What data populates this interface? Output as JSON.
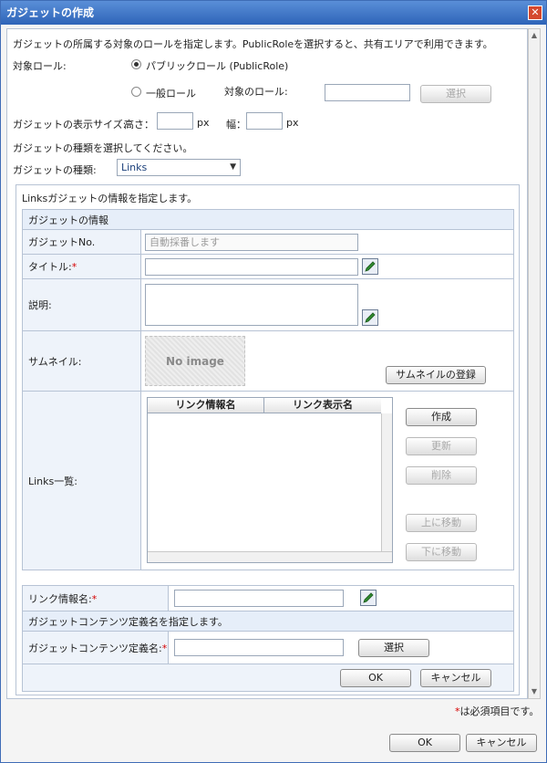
{
  "window": {
    "title": "ガジェットの作成"
  },
  "role": {
    "intro": "ガジェットの所属する対象のロールを指定します。PublicRoleを選択すると、共有エリアで利用できます。",
    "label": "対象ロール:",
    "public_option": "パブリックロール (PublicRole)",
    "general_option": "一般ロール",
    "target_label": "対象のロール:",
    "target_value": "",
    "select_button": "選択"
  },
  "size": {
    "label": "ガジェットの表示サイズ:",
    "height_label": "高さ：",
    "height_value": "",
    "height_unit": "px",
    "width_label": "幅：",
    "width_value": "",
    "width_unit": "px"
  },
  "type": {
    "intro": "ガジェットの種類を選択してください。",
    "label": "ガジェットの種類:",
    "selected": "Links"
  },
  "links_panel": {
    "intro": "Linksガジェットの情報を指定します。",
    "section_title": "ガジェットの情報",
    "gadget_no_label": "ガジェットNo.",
    "gadget_no_value": "自動採番します",
    "title_label": "タイトル:",
    "title_value": "",
    "description_label": "説明:",
    "description_value": "",
    "thumbnail_label": "サムネイル:",
    "thumbnail_placeholder": "No image",
    "thumbnail_button": "サムネイルの登録",
    "links_list_label": "Links一覧:",
    "links_columns": [
      "リンク情報名",
      "リンク表示名"
    ],
    "links_rows": [],
    "btn_create": "作成",
    "btn_update": "更新",
    "btn_delete": "削除",
    "btn_move_up": "上に移動",
    "btn_move_down": "下に移動",
    "link_info_label": "リンク情報名:",
    "link_info_value": "",
    "content_def_intro": "ガジェットコンテンツ定義名を指定します。",
    "content_def_label": "ガジェットコンテンツ定義名:",
    "content_def_value": "",
    "content_def_select": "選択",
    "ok": "OK",
    "cancel": "キャンセル"
  },
  "footer": {
    "required_mark": "*",
    "required_note": "は必須項目です。",
    "ok": "OK",
    "cancel": "キャンセル"
  },
  "required_mark": "*",
  "colors": {
    "titlebar": "#2e64b8",
    "required": "#d60000",
    "label_bg": "#eef3fa"
  }
}
